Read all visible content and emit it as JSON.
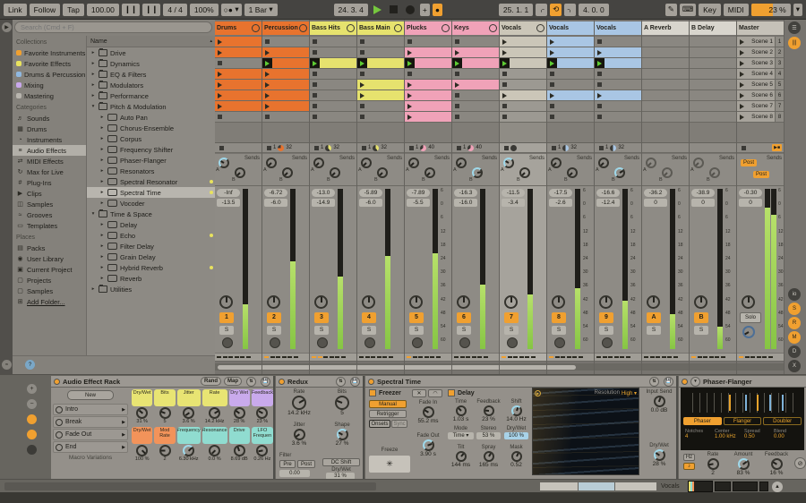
{
  "icons": {
    "play": "▶",
    "stop": "■",
    "record": "●",
    "plus": "+",
    "dropdown": "▾",
    "loop": "⟲",
    "punch_in": "⌌",
    "punch_out": "⌍",
    "pencil": "✎",
    "keyboard": "⌨",
    "sort": "▴",
    "snowflake": "✳",
    "phase": "⊘",
    "note": "♪",
    "up": "▲",
    "menu": "☰",
    "lines": "|||",
    "groove": "≈",
    "help": "?",
    "fold": "▶",
    "back_to_arr": "▶■",
    "xfade": "✕",
    "curve": "◠",
    "nudge_l": "❙❙",
    "nudge_r": "❙❙",
    "metronome": "○●"
  },
  "toolbar": {
    "link": "Link",
    "follow": "Follow",
    "tap": "Tap",
    "tempo": "100.00",
    "signature": "4 / 4",
    "groove_amount": "100%",
    "quantize": "1 Bar",
    "arr_position": "24. 3. 4",
    "loop_start": "25. 1. 1",
    "loop_length": "4. 0. 0",
    "key": "Key",
    "midi": "MIDI",
    "cpu": "23 %"
  },
  "browser": {
    "search_placeholder": "Search (Cmd + F)",
    "collections_title": "Collections",
    "collections": [
      {
        "label": "Favorite Instruments",
        "color": "#f0a030"
      },
      {
        "label": "Favorite Effects",
        "color": "#e8e25e"
      },
      {
        "label": "Drums & Percussion",
        "color": "#8fb8e0"
      },
      {
        "label": "Mixing",
        "color": "#c9a8ec"
      },
      {
        "label": "Mastering",
        "color": "#b8b5ae"
      }
    ],
    "categories_title": "Categories",
    "categories": [
      {
        "label": "Sounds",
        "icon": "♬"
      },
      {
        "label": "Drums",
        "icon": "▦"
      },
      {
        "label": "Instruments",
        "icon": "◔"
      },
      {
        "label": "Audio Effects",
        "icon": "≡",
        "selected": true
      },
      {
        "label": "MIDI Effects",
        "icon": "⇄"
      },
      {
        "label": "Max for Live",
        "icon": "↻"
      },
      {
        "label": "Plug-Ins",
        "icon": "#"
      },
      {
        "label": "Clips",
        "icon": "▶"
      },
      {
        "label": "Samples",
        "icon": "◫"
      },
      {
        "label": "Grooves",
        "icon": "≈"
      },
      {
        "label": "Templates",
        "icon": "▭"
      }
    ],
    "places_title": "Places",
    "places": [
      {
        "label": "Packs",
        "icon": "▤"
      },
      {
        "label": "User Library",
        "icon": "◉"
      },
      {
        "label": "Current Project",
        "icon": "▣"
      },
      {
        "label": "Projects",
        "icon": "▢"
      },
      {
        "label": "Samples",
        "icon": "▢"
      },
      {
        "label": "Add Folder...",
        "icon": "⊞",
        "underline": true
      }
    ],
    "tree_header": "Name",
    "tree": [
      {
        "label": "Drive",
        "indent": 1,
        "type": "folder",
        "open": false
      },
      {
        "label": "Dynamics",
        "indent": 1,
        "type": "folder",
        "open": false
      },
      {
        "label": "EQ & Filters",
        "indent": 1,
        "type": "folder",
        "open": false
      },
      {
        "label": "Modulators",
        "indent": 1,
        "type": "folder",
        "open": false
      },
      {
        "label": "Performance",
        "indent": 1,
        "type": "folder",
        "open": false
      },
      {
        "label": "Pitch & Modulation",
        "indent": 1,
        "type": "folder",
        "open": true
      },
      {
        "label": "Auto Pan",
        "indent": 2,
        "type": "device"
      },
      {
        "label": "Chorus-Ensemble",
        "indent": 2,
        "type": "device"
      },
      {
        "label": "Corpus",
        "indent": 2,
        "type": "device"
      },
      {
        "label": "Frequency Shifter",
        "indent": 2,
        "type": "device"
      },
      {
        "label": "Phaser-Flanger",
        "indent": 2,
        "type": "device"
      },
      {
        "label": "Resonators",
        "indent": 2,
        "type": "device"
      },
      {
        "label": "Spectral Resonator",
        "indent": 2,
        "type": "device",
        "dot": true
      },
      {
        "label": "Spectral Time",
        "indent": 2,
        "type": "device",
        "dot": true,
        "selected": true
      },
      {
        "label": "Vocoder",
        "indent": 2,
        "type": "device"
      },
      {
        "label": "Time & Space",
        "indent": 1,
        "type": "folder",
        "open": true
      },
      {
        "label": "Delay",
        "indent": 2,
        "type": "device"
      },
      {
        "label": "Echo",
        "indent": 2,
        "type": "device",
        "dot": true
      },
      {
        "label": "Filter Delay",
        "indent": 2,
        "type": "device"
      },
      {
        "label": "Grain Delay",
        "indent": 2,
        "type": "device"
      },
      {
        "label": "Hybrid Reverb",
        "indent": 2,
        "type": "device",
        "dot": true
      },
      {
        "label": "Reverb",
        "indent": 2,
        "type": "device"
      },
      {
        "label": "Utilities",
        "indent": 1,
        "type": "folder",
        "open": false
      }
    ]
  },
  "session": {
    "sends_label": "Sends",
    "send_a": "A",
    "send_b": "B",
    "post_label": "Post",
    "solo_label": "S",
    "master_solo_label": "Solo",
    "db_scale": [
      "6",
      "0",
      "6",
      "12",
      "18",
      "24",
      "30",
      "36",
      "42",
      "48",
      "54",
      "60"
    ],
    "scene_numbers": [
      "1",
      "2",
      "3",
      "4",
      "5",
      "6",
      "7",
      "8"
    ],
    "right_toggles": [
      {
        "label": "io",
        "on": false
      },
      {
        "label": "S",
        "on": true
      },
      {
        "label": "R",
        "on": true
      },
      {
        "label": "M",
        "on": true
      },
      {
        "label": "D",
        "on": false
      },
      {
        "label": "X",
        "on": false
      },
      {
        "label": "▮",
        "on": true
      }
    ],
    "tracks": [
      {
        "name": "Drums",
        "color": "#e8732e",
        "clips": [
          "p",
          "p",
          "s",
          "p",
          "p",
          "p",
          "p",
          "s"
        ],
        "status": {
          "stop": true
        },
        "peak": "-Inf",
        "fader": "-13.5",
        "meter": 28,
        "num": "1",
        "arm": true,
        "dash_on": 0,
        "send_a_rot": -60,
        "send_a_cy": true
      },
      {
        "name": "Percussion",
        "color": "#e8732e",
        "clips": [
          "s",
          "p",
          "g",
          "p",
          "p",
          "p",
          "p",
          "s"
        ],
        "status": {
          "stop": true,
          "n1": "1",
          "n2": "32",
          "pie": 0.75,
          "pie_color": "#e8732e"
        },
        "peak": "-6.72",
        "fader": "-6.0",
        "meter": 55,
        "num": "2",
        "arm": true,
        "dash_on": 1
      },
      {
        "name": "Bass Hits",
        "color": "#e6e26e",
        "clips": [
          "s",
          "s",
          "g",
          "s",
          "s",
          "s",
          "s",
          "s"
        ],
        "status": {
          "stop": true,
          "n1": "1",
          "n2": "32",
          "pie": 0.4,
          "pie_color": "#e6e26e"
        },
        "peak": "-13.0",
        "fader": "-14.9",
        "meter": 45,
        "num": "3",
        "arm": true,
        "dash_on": 2
      },
      {
        "name": "Bass Main",
        "color": "#e6e26e",
        "clips": [
          "s",
          "s",
          "g",
          "s",
          "p",
          "p",
          "s",
          "s"
        ],
        "status": {
          "stop": true,
          "n1": "1",
          "n2": "32",
          "pie": 0.4,
          "pie_color": "#e6e26e"
        },
        "peak": "-5.89",
        "fader": "-6.0",
        "meter": 58,
        "num": "4",
        "arm": true,
        "dash_on": 0
      },
      {
        "name": "Plucks",
        "color": "#f0a2b8",
        "clips": [
          "s",
          "p",
          "g",
          "s",
          "p",
          "p",
          "p",
          "p"
        ],
        "status": {
          "stop": true,
          "n1": "1",
          "n2": "40",
          "pie": 0.65,
          "pie_color": "#f0a2b8"
        },
        "peak": "-7.89",
        "fader": "-5.5",
        "meter": 60,
        "num": "5",
        "arm": true,
        "scale": true,
        "dash_on": 1
      },
      {
        "name": "Keys",
        "color": "#f0a2b8",
        "clips": [
          "s",
          "p",
          "g",
          "s",
          "p",
          "s",
          "s",
          "s"
        ],
        "status": {
          "stop": true,
          "n1": "1",
          "n2": "40",
          "pie": 0.65,
          "pie_color": "#f0a2b8"
        },
        "peak": "-16.3",
        "fader": "-16.0",
        "meter": 40,
        "num": "6",
        "arm": true,
        "dash_on": 0,
        "send_b_rot": 80,
        "send_b_cy": true
      },
      {
        "name": "Vocals",
        "color": "#cbc6b8",
        "clips": [
          "p",
          "p",
          "g",
          "s",
          "s",
          "p",
          "s",
          "s"
        ],
        "status": {
          "stop": true,
          "pie": 0.9,
          "pie_color": "#3a3935"
        },
        "peak": "-11.5",
        "fader": "-3.4",
        "meter": 34,
        "num": "7",
        "arm": true,
        "selected": true,
        "dash_on": 1,
        "send_a_rot": -60,
        "send_a_cy": true
      },
      {
        "name": "Vocals",
        "color": "#a9c6e4",
        "clips": [
          "p",
          "p",
          "g",
          "s",
          "s",
          "p",
          "s",
          "s"
        ],
        "status": {
          "stop": true,
          "n1": "1",
          "n2": "32",
          "pie": 0.5,
          "pie_color": "#a9c6e4"
        },
        "peak": "-17.5",
        "fader": "-2.6",
        "meter": 38,
        "num": "8",
        "arm": true,
        "scale": true,
        "dash_on": 1
      },
      {
        "name": "Vocals",
        "color": "#a9c6e4",
        "clips": [
          "s",
          "p",
          "g",
          "s",
          "s",
          "p",
          "s",
          "s"
        ],
        "status": {
          "stop": true,
          "n1": "1",
          "n2": "32",
          "pie": 0.5,
          "pie_color": "#a9c6e4"
        },
        "peak": "-16.6",
        "fader": "-12.4",
        "meter": 30,
        "num": "9",
        "arm": true,
        "scale": true,
        "dash_on": 0,
        "send_b_rot": 60,
        "send_b_cy": true
      },
      {
        "name": "A Reverb",
        "color": "#d8d5cd",
        "clips": [
          "e",
          "e",
          "e",
          "e",
          "e",
          "e",
          "e",
          "e"
        ],
        "status": null,
        "peak": "-36.2",
        "fader": "0",
        "meter": 22,
        "num": "A",
        "arm": false,
        "is_return": true,
        "scale": true,
        "dash_on": 0
      },
      {
        "name": "B Delay",
        "color": "#d8d5cd",
        "clips": [
          "e",
          "e",
          "e",
          "e",
          "e",
          "e",
          "e",
          "e"
        ],
        "status": null,
        "peak": "-38.9",
        "fader": "0",
        "meter": 14,
        "num": "B",
        "arm": false,
        "is_return": true,
        "scale": true,
        "dash_on": 1
      },
      {
        "name": "Master",
        "color": "#c5c1b8",
        "clips": [
          "scene",
          "scene",
          "scene",
          "scene",
          "scene",
          "scene",
          "scene",
          "scene"
        ],
        "status": {
          "stop": true,
          "back": true
        },
        "peak": "-0.30",
        "fader": "0",
        "meter": 88,
        "is_master": true,
        "scale": true,
        "dash_on": 1,
        "scenes": [
          "Scene 1",
          "Scene 2",
          "Scene 3",
          "Scene 4",
          "Scene 5",
          "Scene 6",
          "Scene 7",
          "Scene 8"
        ]
      }
    ]
  },
  "devices": {
    "rack": {
      "title": "Audio Effect Rack",
      "rand": "Rand",
      "map": "Map",
      "new_label": "New",
      "variations": [
        "Intro",
        "Break",
        "Fade Out",
        "End"
      ],
      "footer": "Macro Variations",
      "macros": [
        {
          "label": "Dry/Wet",
          "color": "#e8e473",
          "value": "31 %",
          "rot": -50
        },
        {
          "label": "Bits",
          "color": "#e8e473",
          "value": "5",
          "rot": -70
        },
        {
          "label": "Jitter",
          "color": "#e8e473",
          "value": "3.6 %",
          "rot": -125
        },
        {
          "label": "Rate",
          "color": "#e8e473",
          "value": "14.2 kHz",
          "rot": 60
        },
        {
          "label": "Dry Wet",
          "color": "#c9aaec",
          "value": "28 %",
          "rot": -55
        },
        {
          "label": "Feedback",
          "color": "#c9aaec",
          "value": "23 %",
          "rot": -62
        },
        {
          "label": "Dry/Wet",
          "color": "#f2935a",
          "value": "100 %",
          "rot": 135
        },
        {
          "label": "Mod Rate",
          "color": "#f2935a",
          "value": "2",
          "rot": -90
        },
        {
          "label": "Frequency",
          "color": "#90dcd0",
          "value": "6.30 kHz",
          "rot": 45,
          "cy": true
        },
        {
          "label": "Resonance",
          "color": "#90dcd0",
          "value": "0.0 %",
          "rot": -135
        },
        {
          "label": "Drive",
          "color": "#90dcd0",
          "value": "8.69 dB",
          "rot": -20
        },
        {
          "label": "LFO Frequen",
          "color": "#90dcd0",
          "value": "0.26 Hz",
          "rot": -100
        }
      ]
    },
    "redux": {
      "title": "Redux",
      "rate_label": "Rate",
      "rate_value": "14.2 kHz",
      "rate_rot": 60,
      "bits_label": "Bits",
      "bits_value": "5",
      "bits_rot": -70,
      "jitter_label": "Jitter",
      "jitter_value": "3.6 %",
      "jitter_rot": -125,
      "shape_label": "Shape",
      "shape_value": "27 %",
      "shape_rot": -60,
      "filter_label": "Filter",
      "pre": "Pre",
      "post": "Post",
      "filter_value": "0.00",
      "dc_shift": "DC Shift",
      "drywet_label": "Dry/Wet",
      "drywet_value": "31 %"
    },
    "spectral": {
      "title": "Spectral Time",
      "freezer": "Freezer",
      "manual": "Manual",
      "retrigger": "Retrigger",
      "onsets": "Onsets",
      "sync": "Sync",
      "fade_in_label": "Fade In",
      "fade_in_value": "55.2 ms",
      "fade_in_rot": -60,
      "fade_out_label": "Fade Out",
      "fade_out_value": "3.90 s",
      "fade_out_rot": 70,
      "freeze_label": "Freeze",
      "delay_label": "Delay",
      "time_label": "Time",
      "time_value": "1.03 s",
      "time_rot": -45,
      "feedback_label": "Feedback",
      "feedback_value": "23 %",
      "feedback_rot": -85,
      "shift_label": "Shift",
      "shift_value": "14.0 Hz",
      "shift_rot": 20,
      "mode_label": "Mode",
      "mode_value": "Time",
      "stereo_label": "Stereo",
      "stereo_value": "53 %",
      "drywet_label": "Dry/Wet",
      "drywet_value": "100 %",
      "tilt_label": "Tilt",
      "tilt_value": "144 ms",
      "tilt_rot": 40,
      "spray_label": "Spray",
      "spray_value": "165 ms",
      "spray_rot": 30,
      "mask_label": "Mask",
      "mask_value": "0.52",
      "mask_rot": 25,
      "resolution_label": "Resolution",
      "resolution_value": "High",
      "input_send_label": "Input Send",
      "input_send_value": "0.0 dB",
      "input_send_rot": 20,
      "out_drywet_label": "Dry/Wet",
      "out_drywet_value": "28 %",
      "out_drywet_rot": -55
    },
    "phaser": {
      "title": "Phaser-Flanger",
      "modes": [
        {
          "label": "Phaser",
          "on": true
        },
        {
          "label": "Flanger",
          "on": false
        },
        {
          "label": "Doubler",
          "on": false
        }
      ],
      "params": [
        {
          "label": "Notches",
          "value": "4"
        },
        {
          "label": "Center",
          "value": "1.00 kHz"
        },
        {
          "label": "Spread",
          "value": "0.50"
        },
        {
          "label": "Blend",
          "value": "0.00"
        }
      ],
      "hz": "Hz",
      "rate_label": "Rate",
      "rate_value": "2",
      "rate_rot": -100,
      "amount_label": "Amount",
      "amount_value": "83 %",
      "amount_rot": 55,
      "feedback_label": "Feedback",
      "feedback_value": "16 %",
      "feedback_rot": -60
    }
  },
  "chainbar": {
    "track_label": "Vocals"
  }
}
